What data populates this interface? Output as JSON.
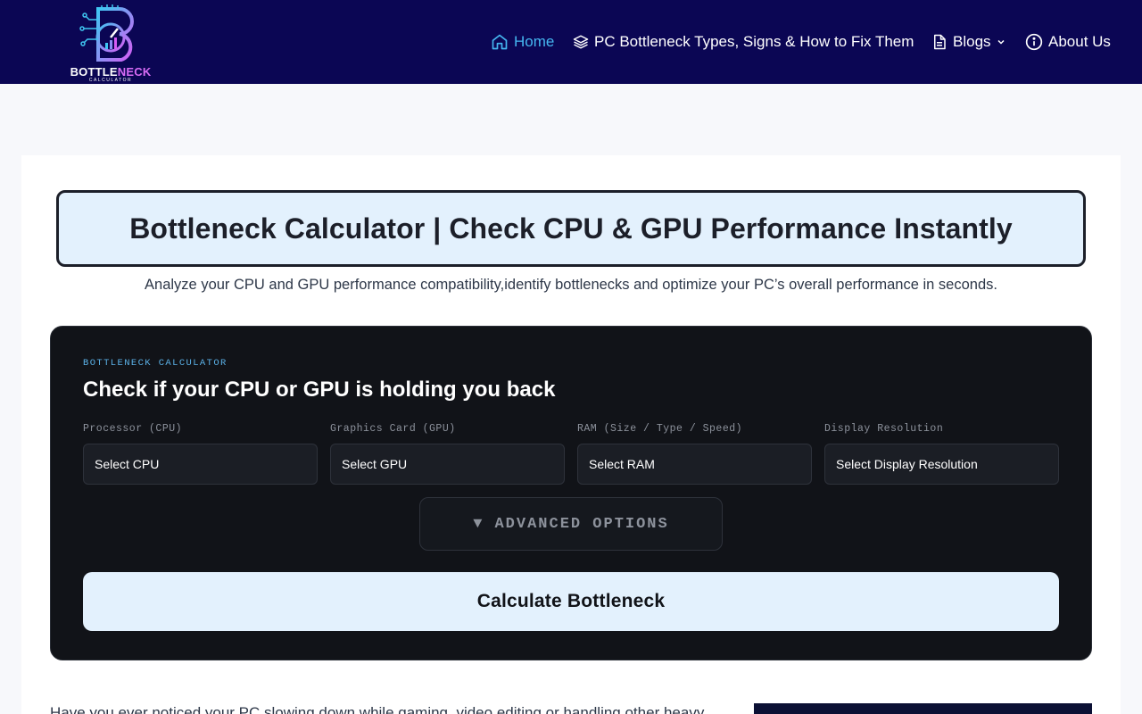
{
  "header": {
    "logo": {
      "word_a": "BOTTLE",
      "word_b": "NECK",
      "sub": "CALCULATOR",
      "icon": "speedometer-b-logo"
    },
    "nav": [
      {
        "label": "Home",
        "icon": "home-icon",
        "active": true
      },
      {
        "label": "PC Bottleneck Types, Signs & How to Fix Them",
        "icon": "layers-icon"
      },
      {
        "label": "Blogs",
        "icon": "document-icon",
        "has_dropdown": true
      },
      {
        "label": "About Us",
        "icon": "info-icon"
      }
    ]
  },
  "hero": {
    "title": "Bottleneck Calculator | Check CPU & GPU Performance Instantly",
    "subtitle": "Analyze your CPU and GPU performance compatibility,identify bottlenecks and optimize your PC’s overall performance in seconds."
  },
  "calculator": {
    "eyebrow": "BOTTLENECK CALCULATOR",
    "heading": "Check if your CPU or GPU is holding you back",
    "fields": [
      {
        "label": "Processor (CPU)",
        "value": "Select CPU"
      },
      {
        "label": "Graphics Card (GPU)",
        "value": "Select GPU"
      },
      {
        "label": "RAM (Size / Type / Speed)",
        "value": "Select RAM"
      },
      {
        "label": "Display Resolution",
        "value": "Select Display Resolution"
      }
    ],
    "advanced": {
      "arrow": "▼",
      "label": "ADVANCED OPTIONS"
    },
    "button": "Calculate Bottleneck"
  },
  "content": {
    "intro": "Have you ever noticed your PC slowing down while gaming, video editing or handling other heavy"
  },
  "colors": {
    "header_bg": "#0b0654",
    "nav_active": "#45b6f0",
    "calc_bg": "#111318",
    "accent_light": "#e3f1fd",
    "eyebrow": "#5bb2e8"
  }
}
